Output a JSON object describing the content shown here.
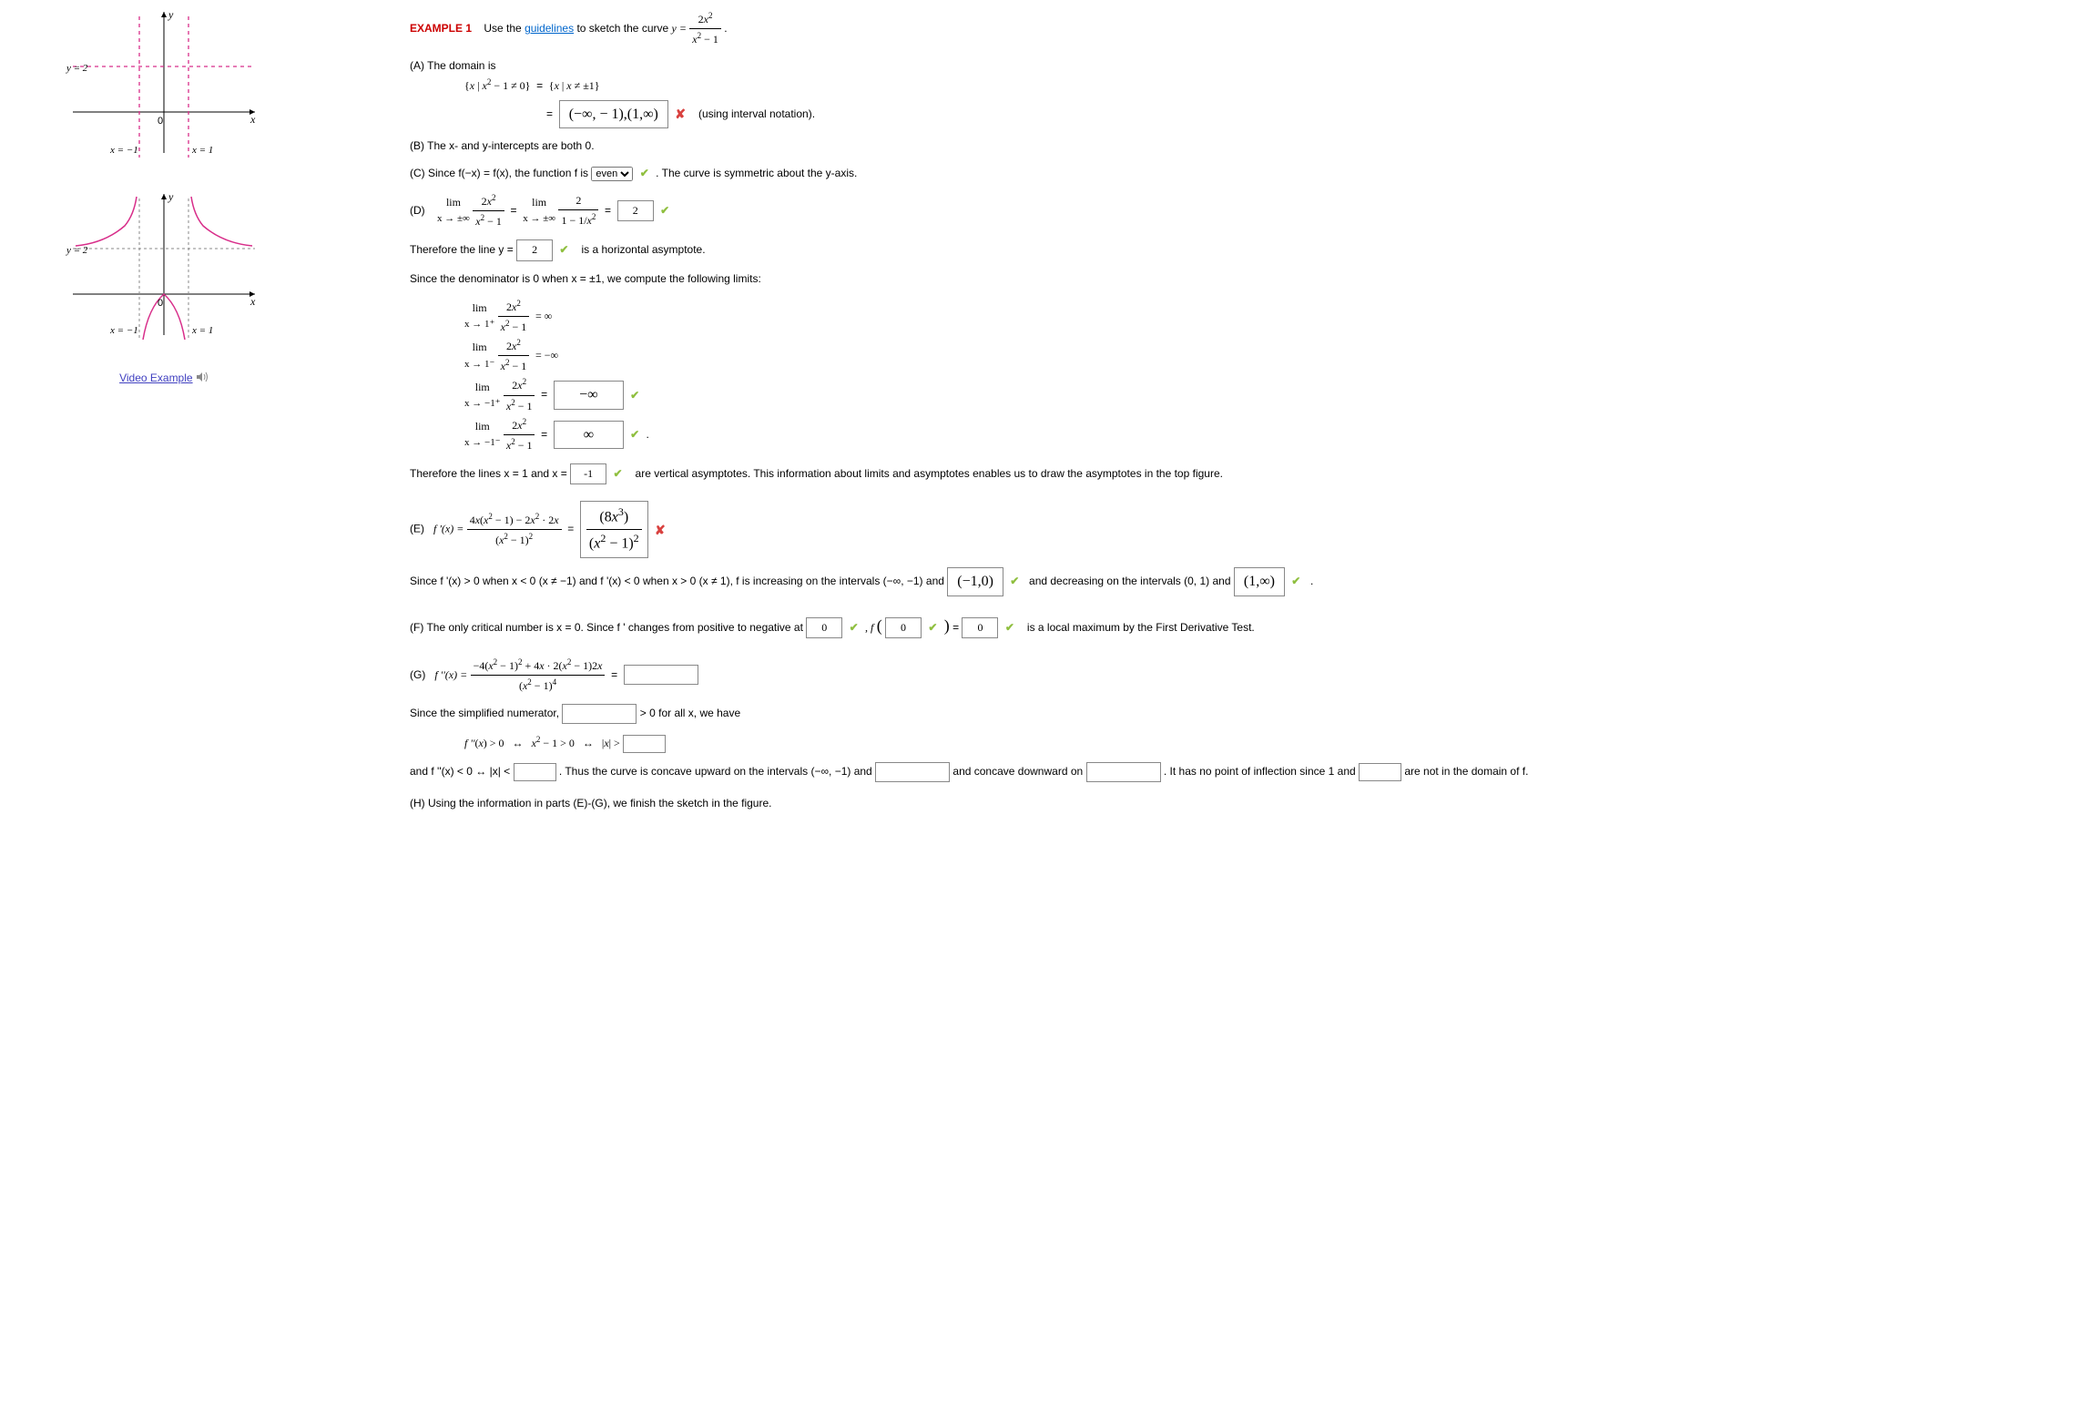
{
  "header": {
    "example_label": "EXAMPLE 1",
    "intro_pre": "Use the ",
    "guidelines": "guidelines",
    "intro_post": " to sketch the curve ",
    "curve_eq_lhs": "y =",
    "curve_num": "2x",
    "curve_den_a": "x",
    "curve_den_b": " − 1",
    "period": "."
  },
  "figures": {
    "video_link": "Video Example",
    "g1": {
      "y2": "y = 2",
      "xm1": "x = −1",
      "xp1": "x = 1",
      "zero": "0",
      "x": "x",
      "y": "y"
    },
    "g2": {
      "y2": "y = 2",
      "xm1": "x = −1",
      "xp1": "x = 1",
      "zero": "0",
      "x": "x",
      "y": "y"
    }
  },
  "A": {
    "label": "(A) The domain is",
    "set_expr": "{x | x² − 1 ≠ 0}   =   {x | x ≠ ±1}",
    "answer": "(−∞, − 1),(1,∞)",
    "note": "(using interval notation)."
  },
  "B": {
    "text": "(B) The x- and y-intercepts are both 0."
  },
  "C": {
    "pre": "(C) Since  f(−x) = f(x),  the function f is",
    "select_value": "even",
    "post": ".  The curve is symmetric about the y-axis."
  },
  "D": {
    "label": "(D)",
    "lim_sub": "x → ±∞",
    "frac1_num": "2x",
    "frac1_den_a": "x",
    "frac1_den_b": " − 1",
    "frac2_num": "2",
    "frac2_den": "1 − 1/x",
    "answer": "2",
    "therefore_pre": "Therefore the line y = ",
    "therefore_ans": "2",
    "therefore_post": " is a horizontal asymptote.",
    "since": "Since the denominator is 0 when  x = ±1,  we compute the following limits:",
    "l1_sub": "x → 1⁺",
    "l1_rhs": "= ∞",
    "l2_sub": "x → 1⁻",
    "l2_rhs": "= −∞",
    "l3_sub": "x → −1⁺",
    "l3_ans": "−∞",
    "l4_sub": "x → −1⁻",
    "l4_ans": "∞",
    "va_pre": "Therefore the lines  x = 1  and  x = ",
    "va_ans": "-1",
    "va_post": " are vertical asymptotes. This information about limits and asymptotes enables us to draw the asymptotes in the top figure."
  },
  "E": {
    "label": "(E)",
    "fprime": "f '(x) =",
    "num": "4x(x² − 1) − 2x² · 2x",
    "den": "(x² − 1)²",
    "ans_num": "(8x³)",
    "ans_den": "(x² − 1)²",
    "since_pre": "Since  f '(x) > 0  when  x < 0 (x ≠ −1)  and  f '(x) < 0  when  x > 0 (x ≠ 1), f  is increasing on the intervals  (−∞, −1)  and",
    "interval1": "(−1,0)",
    "since_mid": "and decreasing on the intervals  (0, 1)  and",
    "interval2": "(1,∞)",
    "period": "."
  },
  "F": {
    "pre": "(F) The only critical number is  x = 0.  Since  f '  changes from positive to negative at ",
    "zero1": "0",
    "mid1": ",  f",
    "f_arg": "0",
    "eq": " = ",
    "zero2": "0",
    "post": " is a local maximum by the First Derivative Test."
  },
  "G": {
    "label": "(G)",
    "fpp": "f ''(x) =",
    "num": "−4(x² − 1)² + 4x · 2(x² − 1)2x",
    "den": "(x² − 1)⁴",
    "since_pre": "Since the simplified numerator, ",
    "since_post": " > 0  for all x, we have",
    "line": "f ''(x) > 0   ↔   x² − 1 > 0   ↔   |x| > ",
    "and_pre": "and  f ''(x) < 0   ↔   |x| < ",
    "thus": ".  Thus the curve is concave upward on the intervals  (−∞, −1)  and ",
    "down": " and concave downward on ",
    "inflect_pre": ".  It has no point of inflection since 1 and ",
    "inflect_post": " are not in the domain of f."
  },
  "H": {
    "text": "(H) Using the information in parts (E)-(G), we finish the sketch in the figure."
  }
}
